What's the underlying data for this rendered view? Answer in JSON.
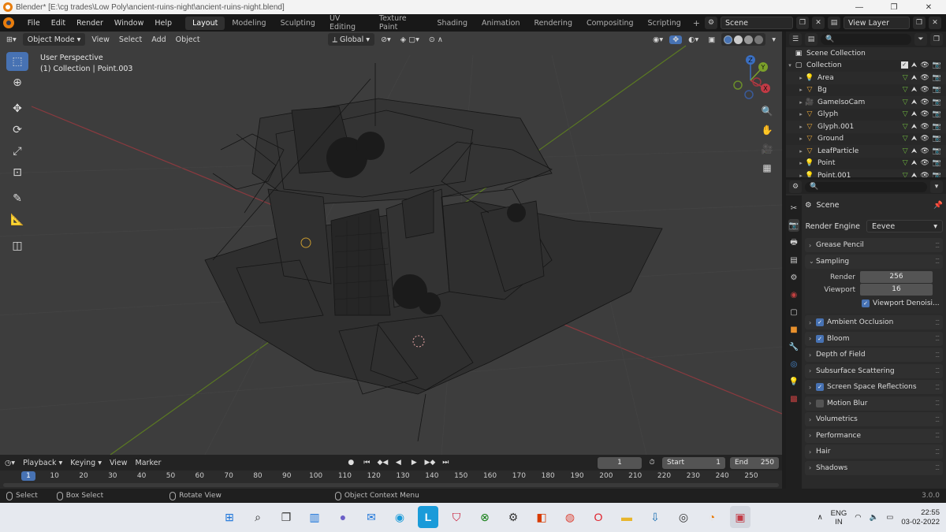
{
  "window": {
    "title": "Blender* [E:\\cg trades\\Low Poly\\ancient-ruins-night\\ancient-ruins-night.blend]",
    "controls": [
      "—",
      "❐",
      "✕"
    ]
  },
  "menu": [
    "File",
    "Edit",
    "Render",
    "Window",
    "Help"
  ],
  "workspaces": [
    {
      "label": "Layout",
      "active": true
    },
    {
      "label": "Modeling"
    },
    {
      "label": "Sculpting"
    },
    {
      "label": "UV Editing"
    },
    {
      "label": "Texture Paint"
    },
    {
      "label": "Shading"
    },
    {
      "label": "Animation"
    },
    {
      "label": "Rendering"
    },
    {
      "label": "Compositing"
    },
    {
      "label": "Scripting"
    }
  ],
  "topright": {
    "scene": "Scene",
    "view_layer": "View Layer"
  },
  "viewport": {
    "mode": "Object Mode",
    "menus": [
      "View",
      "Select",
      "Add",
      "Object"
    ],
    "orientation": "Global",
    "info_line1": "User Perspective",
    "info_line2": "(1) Collection | Point.003",
    "gizmo_labels": {
      "z": "Z",
      "y": "Y",
      "x": "X"
    }
  },
  "outliner": {
    "header": "Scene Collection",
    "collection": "Collection",
    "items": [
      {
        "name": "Area",
        "icon": "light-icon",
        "color": "#e7a63a"
      },
      {
        "name": "Bg",
        "icon": "mesh-icon",
        "color": "#e7a63a"
      },
      {
        "name": "GameIsoCam",
        "icon": "camera-icon",
        "color": "#e7a63a"
      },
      {
        "name": "Glyph",
        "icon": "mesh-icon",
        "color": "#e7a63a"
      },
      {
        "name": "Glyph.001",
        "icon": "mesh-icon",
        "color": "#e7a63a"
      },
      {
        "name": "Ground",
        "icon": "mesh-icon",
        "color": "#e7a63a"
      },
      {
        "name": "LeafParticle",
        "icon": "mesh-icon",
        "color": "#e7a63a"
      },
      {
        "name": "Point",
        "icon": "light-icon",
        "color": "#e7a63a"
      },
      {
        "name": "Point.001",
        "icon": "light-icon",
        "color": "#e7a63a"
      }
    ]
  },
  "properties": {
    "context": "Scene",
    "render_engine_label": "Render Engine",
    "render_engine": "Eevee",
    "panels": [
      {
        "label": "Grease Pencil",
        "checkbox": null
      },
      {
        "label": "Sampling",
        "checkbox": null,
        "expanded": true
      },
      {
        "label": "Ambient Occlusion",
        "checkbox": true
      },
      {
        "label": "Bloom",
        "checkbox": true
      },
      {
        "label": "Depth of Field",
        "checkbox": null
      },
      {
        "label": "Subsurface Scattering",
        "checkbox": null
      },
      {
        "label": "Screen Space Reflections",
        "checkbox": true
      },
      {
        "label": "Motion Blur",
        "checkbox": false
      },
      {
        "label": "Volumetrics",
        "checkbox": null
      },
      {
        "label": "Performance",
        "checkbox": null
      },
      {
        "label": "Hair",
        "checkbox": null
      },
      {
        "label": "Shadows",
        "checkbox": null
      }
    ],
    "sampling": {
      "render_label": "Render",
      "render_value": "256",
      "viewport_label": "Viewport",
      "viewport_value": "16",
      "denoise_label": "Viewport Denoisi..."
    }
  },
  "timeline": {
    "menus": [
      "Playback",
      "Keying",
      "View",
      "Marker"
    ],
    "current_frame": "1",
    "start_label": "Start",
    "start": "1",
    "end_label": "End",
    "end": "250",
    "ticks": [
      "10",
      "20",
      "30",
      "40",
      "50",
      "60",
      "70",
      "80",
      "90",
      "100",
      "110",
      "120",
      "130",
      "140",
      "150",
      "160",
      "170",
      "180",
      "190",
      "200",
      "210",
      "220",
      "230",
      "240",
      "250"
    ],
    "cursor": "1"
  },
  "status": {
    "select": "Select",
    "box_select": "Box Select",
    "rotate": "Rotate View",
    "context_menu": "Object Context Menu",
    "version": "3.0.0"
  },
  "taskbar": {
    "lang1": "ENG",
    "lang2": "IN",
    "time": "22:55",
    "date": "03-02-2022"
  },
  "colors": {
    "accent": "#4772b3",
    "x_axis": "#c1333f",
    "y_axis": "#6b9d22",
    "blender_orange": "#e87d0d"
  }
}
